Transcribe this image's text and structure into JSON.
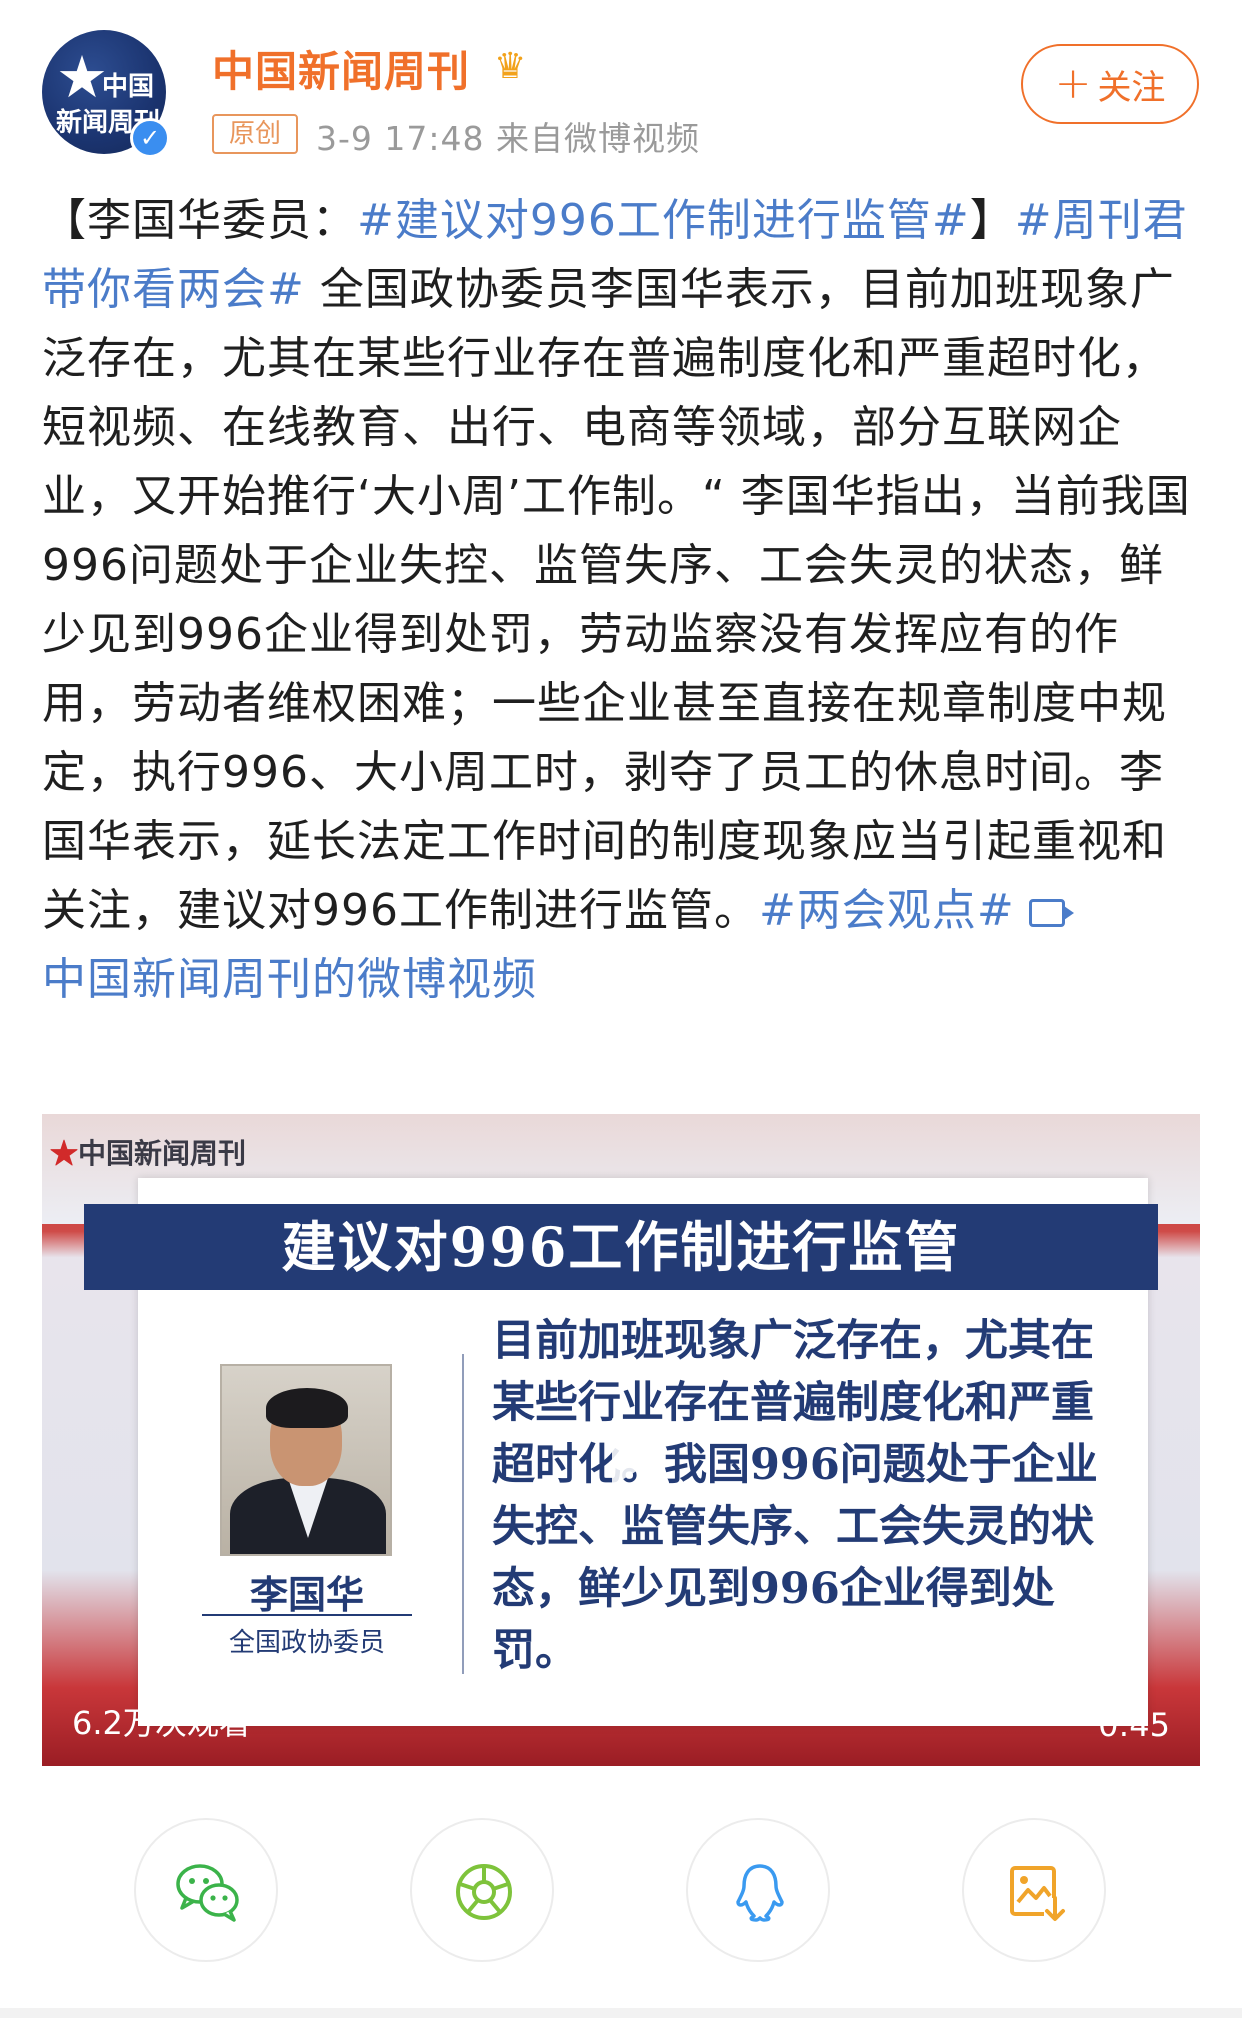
{
  "header": {
    "avatar_text_top": "中国",
    "avatar_text_bottom": "新闻周刊",
    "username": "中国新闻周刊",
    "original_badge": "原创",
    "meta": "3-9 17:48  来自微博视频",
    "follow_label": "关注"
  },
  "post": {
    "p1": "【李国华委员：",
    "tag1": "#建议对996工作制进行监管#",
    "p2": "】",
    "tag2": "#周刊君带你看两会#",
    "p3": " 全国政协委员李国华表示，目前加班现象广泛存在，尤其在某些行业存在普遍制度化和严重超时化，短视频、在线教育、出行、电商等领域，部分互联网企业，又开始推行‘大小周’工作制。“ 李国华指出，当前我国996问题处于企业失控、监管失序、工会失灵的状态，鲜少见到996企业得到处罚，劳动监察没有发挥应有的作用，劳动者维权困难；一些企业甚至直接在规章制度中规定，执行996、大小周工时，剥夺了员工的休息时间。李国华表示，延长法定工作时间的制度现象应当引起重视和关注，建议对996工作制进行监管。",
    "tag3": "#两会观点#",
    "video_link": "中国新闻周刊的微博视频"
  },
  "video": {
    "brand": "中国新闻周刊",
    "title": "建议对996工作制进行监管",
    "person_name": "李国华",
    "person_role": "全国政协委员",
    "quote": "目前加班现象广泛存在，尤其在某些行业存在普遍制度化和严重超时化。我国996问题处于企业失控、监管失序、工会失灵的状态，鲜少见到996企业得到处罚。",
    "views": "6.2万次观看",
    "duration": "0:45"
  },
  "share": {
    "icons": [
      "wechat-icon",
      "moments-icon",
      "qq-icon",
      "save-image-icon"
    ]
  },
  "colors": {
    "accent": "#f0702a",
    "link": "#4b7cc9",
    "video_title_bg": "#233b75"
  }
}
